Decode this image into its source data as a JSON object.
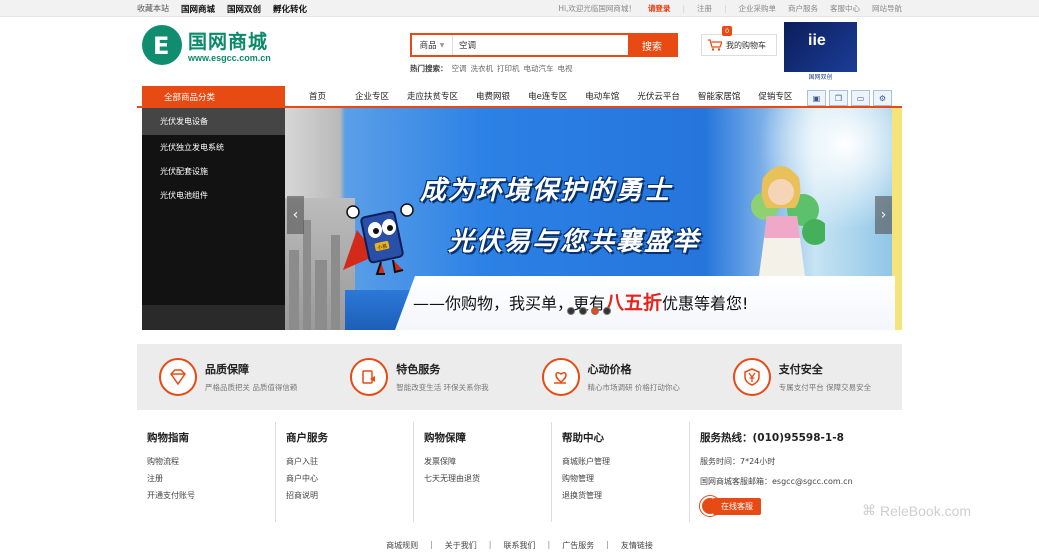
{
  "topbar": {
    "left": [
      "收藏本站",
      "国网商城",
      "国网双创",
      "孵化转化"
    ],
    "welcome": "Hi,欢迎光临国网商城！",
    "login": "请登录",
    "register": "注册",
    "links": [
      "企业采购单",
      "商户服务",
      "客服中心",
      "网站导航"
    ]
  },
  "header": {
    "logo_name": "国网商城",
    "logo_url": "www.esgcc.com.cn",
    "search_category": "商品",
    "search_value": "空调",
    "search_button": "搜索",
    "hot_label": "热门搜索：",
    "hot_terms": [
      "空调",
      "洗衣机",
      "打印机",
      "电动汽车",
      "电视"
    ],
    "cart_label": "我的购物车",
    "cart_count": "0",
    "brand_caption": "国网双创"
  },
  "nav": {
    "all_categories": "全部商品分类",
    "items": [
      "首页",
      "企业专区",
      "走应扶贫专区",
      "电费网银",
      "电e连专区",
      "电动车馆",
      "光伏云平台",
      "智能家居馆",
      "促销专区"
    ],
    "tools": [
      "save-icon",
      "copy-icon",
      "screen-icon",
      "settings-icon"
    ]
  },
  "sidebar": {
    "items": [
      "光伏发电设备",
      "光伏独立发电系统",
      "光伏配套设施",
      "光伏电池组件"
    ]
  },
  "banner": {
    "line1": "成为环境保护的勇士",
    "line2": "光伏易与您共襄盛举",
    "line3_pre": "——你购物，我买单，更有",
    "line3_hl": "八五折",
    "line3_post": "优惠等着您!",
    "mascot_tag": "小易",
    "slides": 4,
    "active_slide": 3
  },
  "services": [
    {
      "title": "品质保障",
      "desc": "严格品质把关 品质值得信赖",
      "icon": "diamond-icon"
    },
    {
      "title": "特色服务",
      "desc": "智能改变生活 环保关系你我",
      "icon": "service-icon"
    },
    {
      "title": "心动价格",
      "desc": "精心市场调研 价格打动你心",
      "icon": "heart-hand-icon"
    },
    {
      "title": "支付安全",
      "desc": "专属支付平台 保障交易安全",
      "icon": "yen-shield-icon"
    }
  ],
  "footer": {
    "columns": [
      {
        "title": "购物指南",
        "links": [
          "购物流程",
          "注册",
          "开通支付账号"
        ]
      },
      {
        "title": "商户服务",
        "links": [
          "商户入驻",
          "商户中心",
          "招商说明"
        ]
      },
      {
        "title": "购物保障",
        "links": [
          "发票保障",
          "七天无理由退货"
        ]
      },
      {
        "title": "帮助中心",
        "links": [
          "商城账户管理",
          "购物管理",
          "退换货管理"
        ]
      }
    ],
    "hotline_title": "服务热线：(010)95598-1-8",
    "service_time": "服务时间：7*24小时",
    "email": "国网商城客服邮箱：esgcc@sgcc.com.cn",
    "online_label": "在线客服"
  },
  "bottom_links": [
    "商城规则",
    "关于我们",
    "联系我们",
    "广告服务",
    "友情链接"
  ],
  "watermark": "ReleBook.com",
  "colors": {
    "accent": "#e84a14",
    "brand_green": "#0f8d6e",
    "sidebar_bg": "#121212"
  }
}
